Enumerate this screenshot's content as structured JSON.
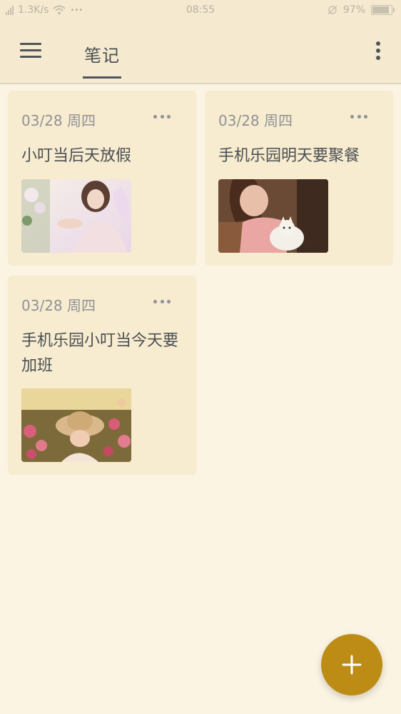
{
  "status_bar": {
    "network_speed": "1.3K/s",
    "extra_indicator": "•••",
    "time": "08:55",
    "battery_percent": "97%",
    "battery_level": 0.97,
    "icons": [
      "signal-icon",
      "wifi-icon",
      "alarm-off-icon",
      "battery-icon"
    ]
  },
  "app_bar": {
    "tab_label": "笔记",
    "icons": [
      "menu-icon",
      "more-vert-icon"
    ]
  },
  "notes": [
    {
      "date": "03/28 周四",
      "title": "小叮当后天放假",
      "image": "girl-with-flowers-photo"
    },
    {
      "date": "03/28 周四",
      "title": "手机乐园明天要聚餐",
      "image": "girl-with-cat-photo"
    },
    {
      "date": "03/28 周四",
      "title": "手机乐园小叮当今天要加班",
      "image": "girl-with-hat-in-roses-photo"
    }
  ],
  "fab": {
    "icon": "plus-icon",
    "color": "#bc8c14"
  },
  "colors": {
    "background": "#fbf4e3",
    "card": "#f7ebd0",
    "appbar": "#f5ead0",
    "accent": "#bc8c14"
  }
}
